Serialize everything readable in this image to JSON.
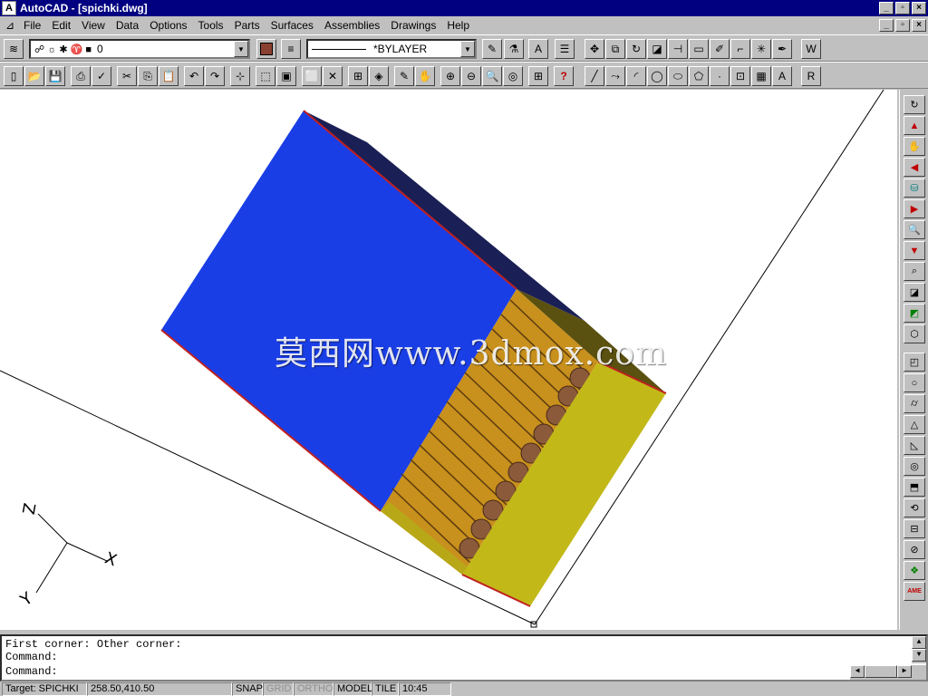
{
  "window": {
    "title": "AutoCAD - [spichki.dwg]"
  },
  "menu": [
    "File",
    "Edit",
    "View",
    "Data",
    "Options",
    "Tools",
    "Parts",
    "Surfaces",
    "Assemblies",
    "Drawings",
    "Help"
  ],
  "layer_combo": {
    "value": "0"
  },
  "linetype_combo": {
    "value": "*BYLAYER"
  },
  "watermark": "莫西网www.3dmox.com",
  "ucs": {
    "x_label": "X",
    "y_label": "Y",
    "z_label": "Z"
  },
  "command": {
    "line1": "First corner: Other corner:",
    "line2": "Command:",
    "line3": "Command:"
  },
  "status": {
    "target": "Target: SPICHKI",
    "coords": "258.50,410.50",
    "snap": "SNAP",
    "grid": "GRID",
    "ortho": "ORTHO",
    "model": "MODEL",
    "tile": "TILE",
    "time": "10:45"
  },
  "toolbar_right_labels": {
    "w": "W",
    "r": "R"
  },
  "colors": {
    "box_blue": "#1a3ee6",
    "box_yellow": "#c2b818",
    "match_wood": "#c8901c",
    "match_head": "#8a5a3a",
    "title_bar": "#000080"
  }
}
